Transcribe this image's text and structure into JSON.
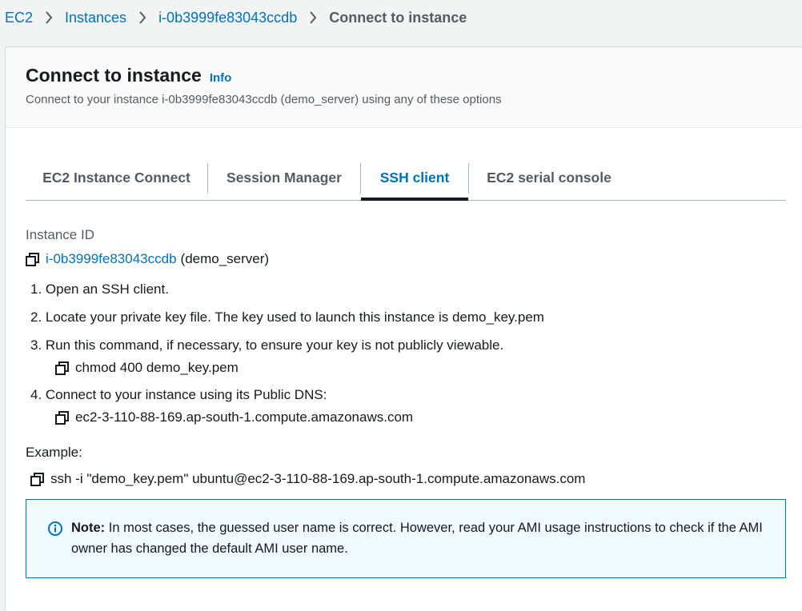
{
  "breadcrumb": {
    "items": [
      "EC2",
      "Instances",
      "i-0b3999fe83043ccdb"
    ],
    "current": "Connect to instance"
  },
  "header": {
    "title": "Connect to instance",
    "info_label": "Info",
    "subtitle": "Connect to your instance i-0b3999fe83043ccdb (demo_server) using any of these options"
  },
  "tabs": [
    {
      "label": "EC2 Instance Connect"
    },
    {
      "label": "Session Manager"
    },
    {
      "label": "SSH client"
    },
    {
      "label": "EC2 serial console"
    }
  ],
  "active_tab": "SSH client",
  "ssh": {
    "instance_id_label": "Instance ID",
    "instance_id": "i-0b3999fe83043ccdb",
    "instance_name": "(demo_server)",
    "steps": [
      "1. Open an SSH client.",
      "2. Locate your private key file. The key used to launch this instance is demo_key.pem",
      "3. Run this command, if necessary, to ensure your key is not publicly viewable.",
      "4. Connect to your instance using its Public DNS:"
    ],
    "chmod_command": "chmod 400 demo_key.pem",
    "public_dns": "ec2-3-110-88-169.ap-south-1.compute.amazonaws.com",
    "example_label": "Example:",
    "example_command": "ssh -i \"demo_key.pem\" ubuntu@ec2-3-110-88-169.ap-south-1.compute.amazonaws.com"
  },
  "note": {
    "bold": "Note:",
    "text": " In most cases, the guessed user name is correct. However, read your AMI usage instructions to check if the AMI owner has changed the default AMI user name."
  },
  "colors": {
    "link": "#0073bb",
    "text": "#16191f",
    "muted": "#545b64",
    "note_bg": "#f1faff",
    "note_border": "#0073bb"
  },
  "icons": [
    "chevron-right-icon",
    "copy-icon",
    "info-circle-icon"
  ]
}
